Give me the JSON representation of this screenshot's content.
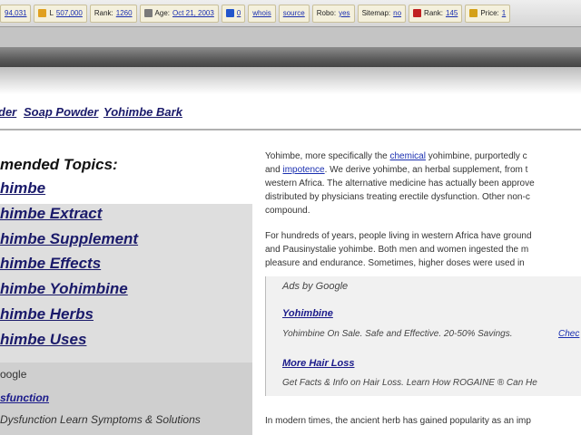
{
  "seo_bar": {
    "items": [
      {
        "key": "",
        "value": "94,031",
        "icon": "none",
        "color": "#3a62c8"
      },
      {
        "key": "L",
        "value": "507,000",
        "icon": "seo-link-icon",
        "color": "#e0a020"
      },
      {
        "key": "Rank:",
        "value": "1260",
        "icon": "none",
        "color": "#4a8a3a"
      },
      {
        "key": "Age:",
        "value": "Oct 21, 2003",
        "icon": "seo-age-icon",
        "color": "#7a7a7a"
      },
      {
        "key": "",
        "value": "0",
        "icon": "seo-delicious-icon",
        "color": "#2255cc"
      },
      {
        "key": "",
        "value": "whois",
        "icon": "none",
        "color": "#999999"
      },
      {
        "key": "",
        "value": "source",
        "icon": "none",
        "color": "#999999"
      },
      {
        "key": "Robo:",
        "value": "yes",
        "icon": "none",
        "color": "#999999"
      },
      {
        "key": "Sitemap:",
        "value": "no",
        "icon": "none",
        "color": "#999999"
      },
      {
        "key": "Rank:",
        "value": "145",
        "icon": "seo-rank-icon",
        "color": "#c02020"
      },
      {
        "key": "Price:",
        "value": "1",
        "icon": "seo-price-icon",
        "color": "#d4a017"
      }
    ]
  },
  "nav": {
    "links": [
      "der",
      "Soap Powder",
      "Yohimbe Bark"
    ]
  },
  "left": {
    "heading": "mended Topics:",
    "topics": [
      "himbe",
      "himbe Extract",
      "himbe Supplement",
      "himbe Effects",
      "himbe Yohimbine",
      "himbe Herbs",
      "himbe Uses"
    ],
    "ad_label": "oogle",
    "ad_title": "sfunction",
    "ad_text": "Dysfunction Learn Symptoms & Solutions"
  },
  "right": {
    "p1_lines": [
      {
        "pre": "Yohimbe, more specifically the ",
        "link": "chemical",
        "post": " yohimbine, purportedly c"
      },
      {
        "pre": "and ",
        "link": "impotence",
        "post": ". We derive yohimbe, an herbal supplement, from t"
      },
      {
        "pre": "western Africa. The alternative medicine has actually been approve",
        "link": "",
        "post": ""
      },
      {
        "pre": "distributed by physicians treating erectile dysfunction. Other non-c",
        "link": "",
        "post": ""
      },
      {
        "pre": "compound.",
        "link": "",
        "post": ""
      }
    ],
    "p2_lines": [
      "For hundreds of years, people living in western Africa have ground",
      "and Pausinystalie yohimbe. Both men and women ingested the m",
      "pleasure and endurance. Sometimes, higher doses were used in"
    ],
    "ads": {
      "header": "Ads by Google",
      "ad1_title": "Yohimbine",
      "ad1_text": "Yohimbine On Sale. Safe and Effective. 20-50% Savings.",
      "ad1_link": "Chec",
      "ad2_title": "More Hair Loss",
      "ad2_text": "Get Facts & Info on Hair Loss. Learn How ROGAINE ® Can He"
    },
    "p3_line": "In modern times, the ancient herb has gained popularity as an imp"
  }
}
